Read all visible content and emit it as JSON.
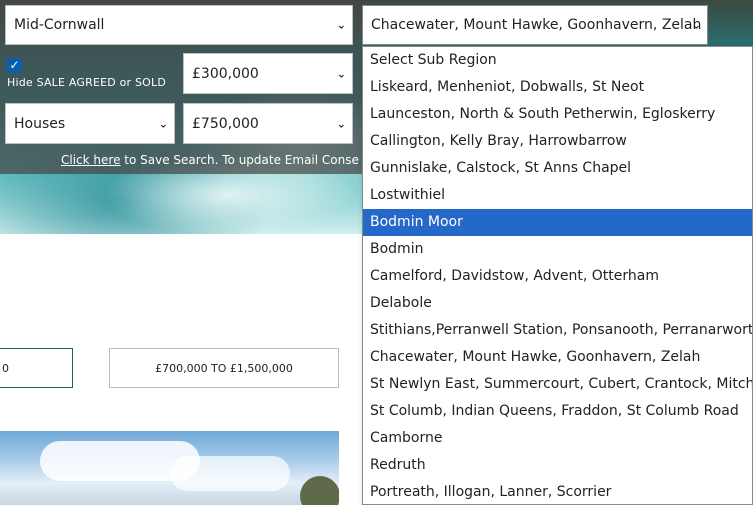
{
  "search": {
    "region_value": "Mid-Cornwall",
    "subregion_value": "Chacewater, Mount Hawke, Goonhavern, Zelah",
    "hide_sold_checked": true,
    "hide_sold_label": "Hide SALE AGREED or SOLD",
    "min_price": "£300,000",
    "property_type": "Houses",
    "max_price": "£750,000",
    "save_link": "Click here",
    "save_text": " to Save Search. To update Email Conse"
  },
  "price_bands": [
    {
      "label": "0"
    },
    {
      "label": "£700,000 TO £1,500,000"
    }
  ],
  "subregion_options": [
    {
      "label": "Select Sub Region",
      "selected": false
    },
    {
      "label": "Liskeard, Menheniot, Dobwalls, St Neot",
      "selected": false
    },
    {
      "label": "Launceston, North & South Petherwin, Egloskerry",
      "selected": false
    },
    {
      "label": "Callington, Kelly Bray, Harrowbarrow",
      "selected": false
    },
    {
      "label": "Gunnislake, Calstock, St Anns Chapel",
      "selected": false
    },
    {
      "label": "Lostwithiel",
      "selected": false
    },
    {
      "label": "Bodmin Moor",
      "selected": true
    },
    {
      "label": "Bodmin",
      "selected": false
    },
    {
      "label": "Camelford, Davidstow, Advent, Otterham",
      "selected": false
    },
    {
      "label": "Delabole",
      "selected": false
    },
    {
      "label": "Stithians,Perranwell Station, Ponsanooth, Perranarworthal",
      "selected": false
    },
    {
      "label": "Chacewater, Mount Hawke, Goonhavern, Zelah",
      "selected": false
    },
    {
      "label": "St Newlyn East, Summercourt, Cubert, Crantock, Mitchell",
      "selected": false
    },
    {
      "label": "St Columb, Indian Queens, Fraddon, St Columb Road",
      "selected": false
    },
    {
      "label": "Camborne",
      "selected": false
    },
    {
      "label": "Redruth",
      "selected": false
    },
    {
      "label": "Portreath, Illogan, Lanner, Scorrier",
      "selected": false
    }
  ],
  "icons": {
    "chevron": "chevron-down-icon",
    "check": "checkmark-icon"
  },
  "colors": {
    "selected_option_bg": "#2468c9",
    "checkbox_bg": "#0b5ea8",
    "price_box_border": "#1f5f6a"
  }
}
